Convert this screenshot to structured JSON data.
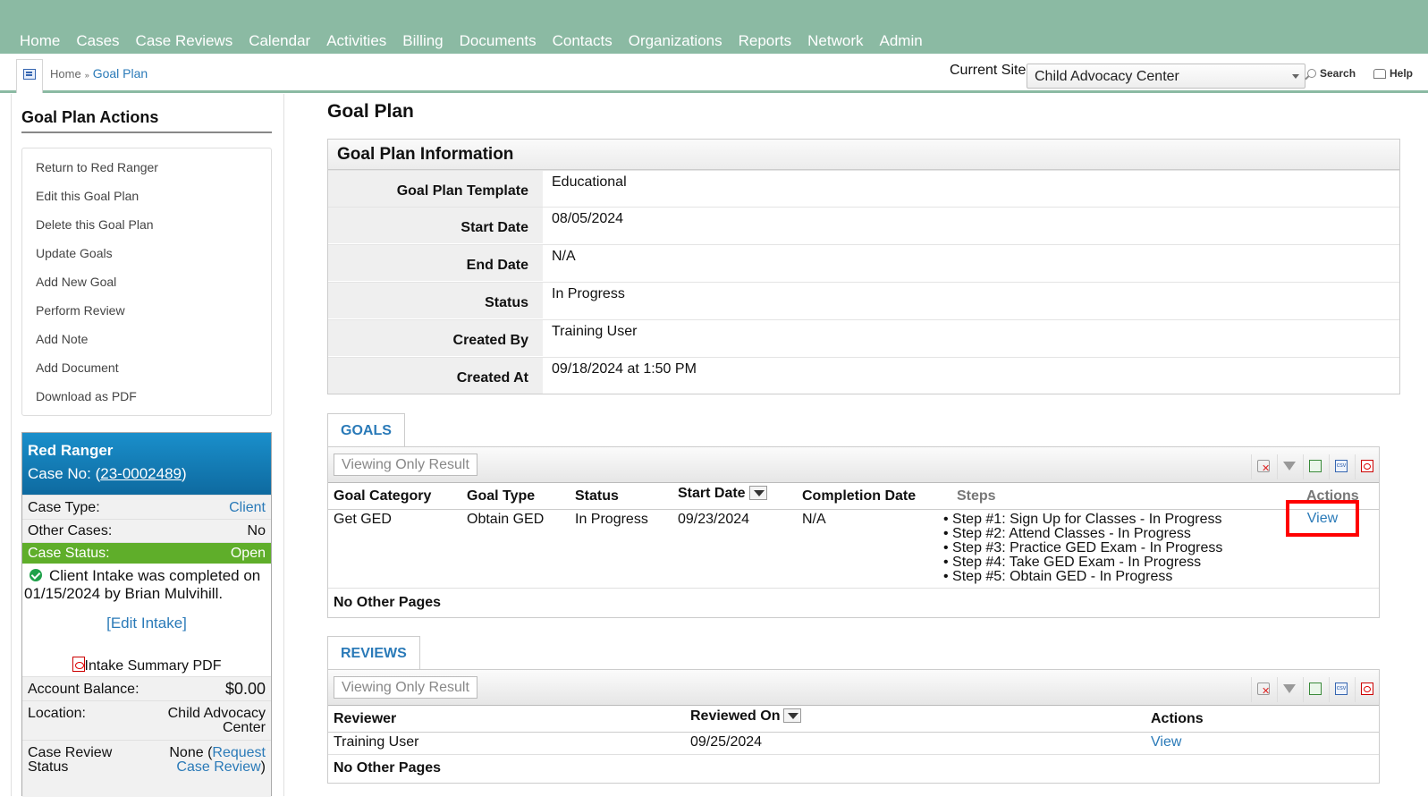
{
  "nav": [
    "Home",
    "Cases",
    "Case Reviews",
    "Calendar",
    "Activities",
    "Billing",
    "Documents",
    "Contacts",
    "Organizations",
    "Reports",
    "Network",
    "Admin"
  ],
  "breadcrumb": {
    "home": "Home",
    "sep": "»",
    "current": "Goal Plan"
  },
  "site": {
    "label": "Current Site",
    "value": "Child Advocacy Center"
  },
  "tools": {
    "search": "Search",
    "help": "Help"
  },
  "left": {
    "title": "Goal Plan Actions",
    "actions": [
      "Return to Red Ranger",
      "Edit this Goal Plan",
      "Delete this Goal Plan",
      "Update Goals",
      "Add New Goal",
      "Perform Review",
      "Add Note",
      "Add Document",
      "Download as PDF"
    ]
  },
  "case": {
    "name": "Red Ranger",
    "case_no_label": "Case No: (",
    "case_no": "23-0002489",
    "case_no_close": ")",
    "type_label": "Case Type:",
    "type_value": "Client",
    "other_label": "Other Cases:",
    "other_value": "No",
    "status_label": "Case Status:",
    "status_value": "Open",
    "intake_msg": "Client Intake was completed on 01/15/2024 by Brian Mulvihill.",
    "edit_intake": "[Edit Intake]",
    "intake_pdf": "Intake Summary PDF",
    "balance_label": "Account Balance:",
    "balance_value": "$0.00",
    "location_label": "Location:",
    "location_value_1": "Child Advocacy",
    "location_value_2": "Center",
    "review_label_1": "Case Review",
    "review_label_2": "Status",
    "review_none": "None (",
    "review_link_1": "Request",
    "review_link_2": "Case Review",
    "review_close": ")"
  },
  "main": {
    "title": "Goal Plan",
    "info_title": "Goal Plan Information",
    "info": [
      {
        "label": "Goal Plan Template",
        "value": "Educational"
      },
      {
        "label": "Start Date",
        "value": "08/05/2024"
      },
      {
        "label": "End Date",
        "value": "N/A"
      },
      {
        "label": "Status",
        "value": "In Progress"
      },
      {
        "label": "Created By",
        "value": "Training User"
      },
      {
        "label": "Created At",
        "value": "09/18/2024 at 1:50 PM"
      }
    ]
  },
  "goals": {
    "tab": "GOALS",
    "viewing": "Viewing Only Result",
    "headers": [
      "Goal Category",
      "Goal Type",
      "Status",
      "Start Date",
      "Completion Date",
      "Steps",
      "Actions"
    ],
    "row": {
      "category": "Get GED",
      "type": "Obtain GED",
      "status": "In Progress",
      "start": "09/23/2024",
      "completion": "N/A",
      "steps": [
        "Step #1: Sign Up for Classes - In Progress",
        "Step #2: Attend Classes - In Progress",
        "Step #3: Practice GED Exam - In Progress",
        "Step #4: Take GED Exam - In Progress",
        "Step #5: Obtain GED - In Progress"
      ],
      "action": "View"
    },
    "footer": "No Other Pages"
  },
  "reviews": {
    "tab": "REVIEWS",
    "viewing": "Viewing Only Result",
    "headers": [
      "Reviewer",
      "Reviewed On",
      "Actions"
    ],
    "row": {
      "reviewer": "Training User",
      "reviewed_on": "09/25/2024",
      "action": "View"
    },
    "footer": "No Other Pages"
  },
  "colors": {
    "nav_bg": "#8bbaa3",
    "case_header": "#1a8fcb",
    "status_open": "#5fae2a",
    "link": "#2a7ab8",
    "highlight": "#ff0000"
  }
}
